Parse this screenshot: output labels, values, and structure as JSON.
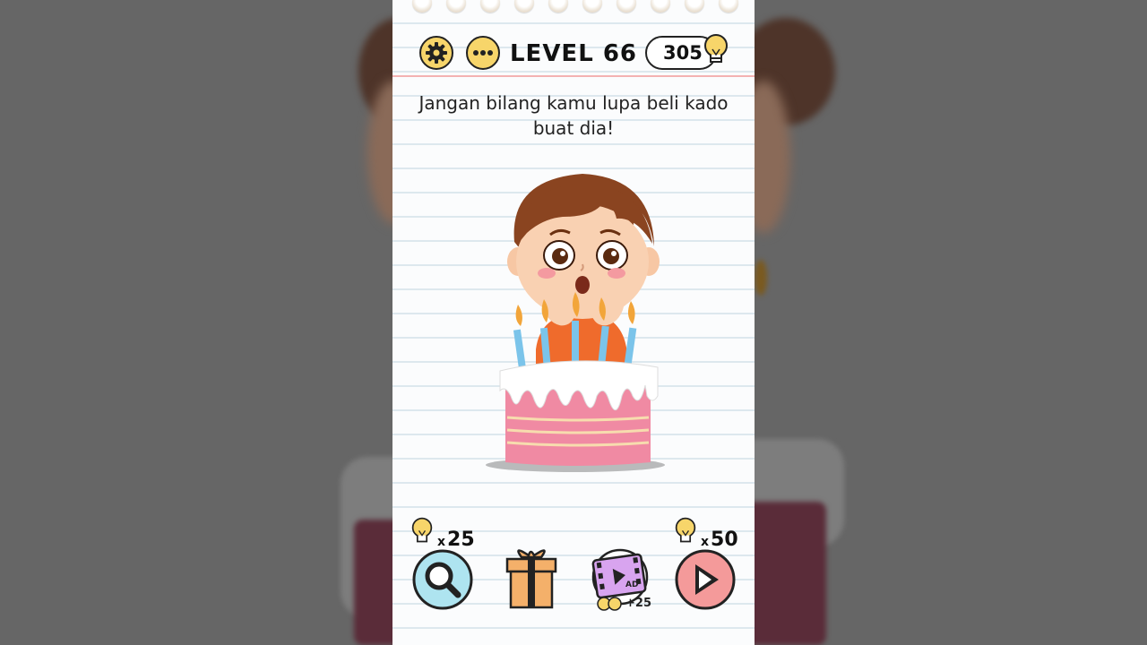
{
  "header": {
    "level_label": "LEVEL 66",
    "coins": "305"
  },
  "question": {
    "text": "Jangan bilang kamu lupa beli kado buat dia!"
  },
  "tools": {
    "magnifier": {
      "cost_prefix": "x",
      "cost": "25"
    },
    "video": {
      "reward": "+25",
      "badge": "AD"
    },
    "skip": {
      "cost_prefix": "x",
      "cost": "50"
    }
  },
  "colors": {
    "hint_yellow": "#f7d56a",
    "magnifier_bg": "#aee4f0",
    "skip_bg": "#f49a9a",
    "cake_pink": "#f08aa3",
    "header_line": "#f3b2b2"
  },
  "icons": [
    "gear-icon",
    "more-icon",
    "lightbulb-icon",
    "magnifier-icon",
    "gift-icon",
    "video-ad-icon",
    "skip-icon"
  ]
}
